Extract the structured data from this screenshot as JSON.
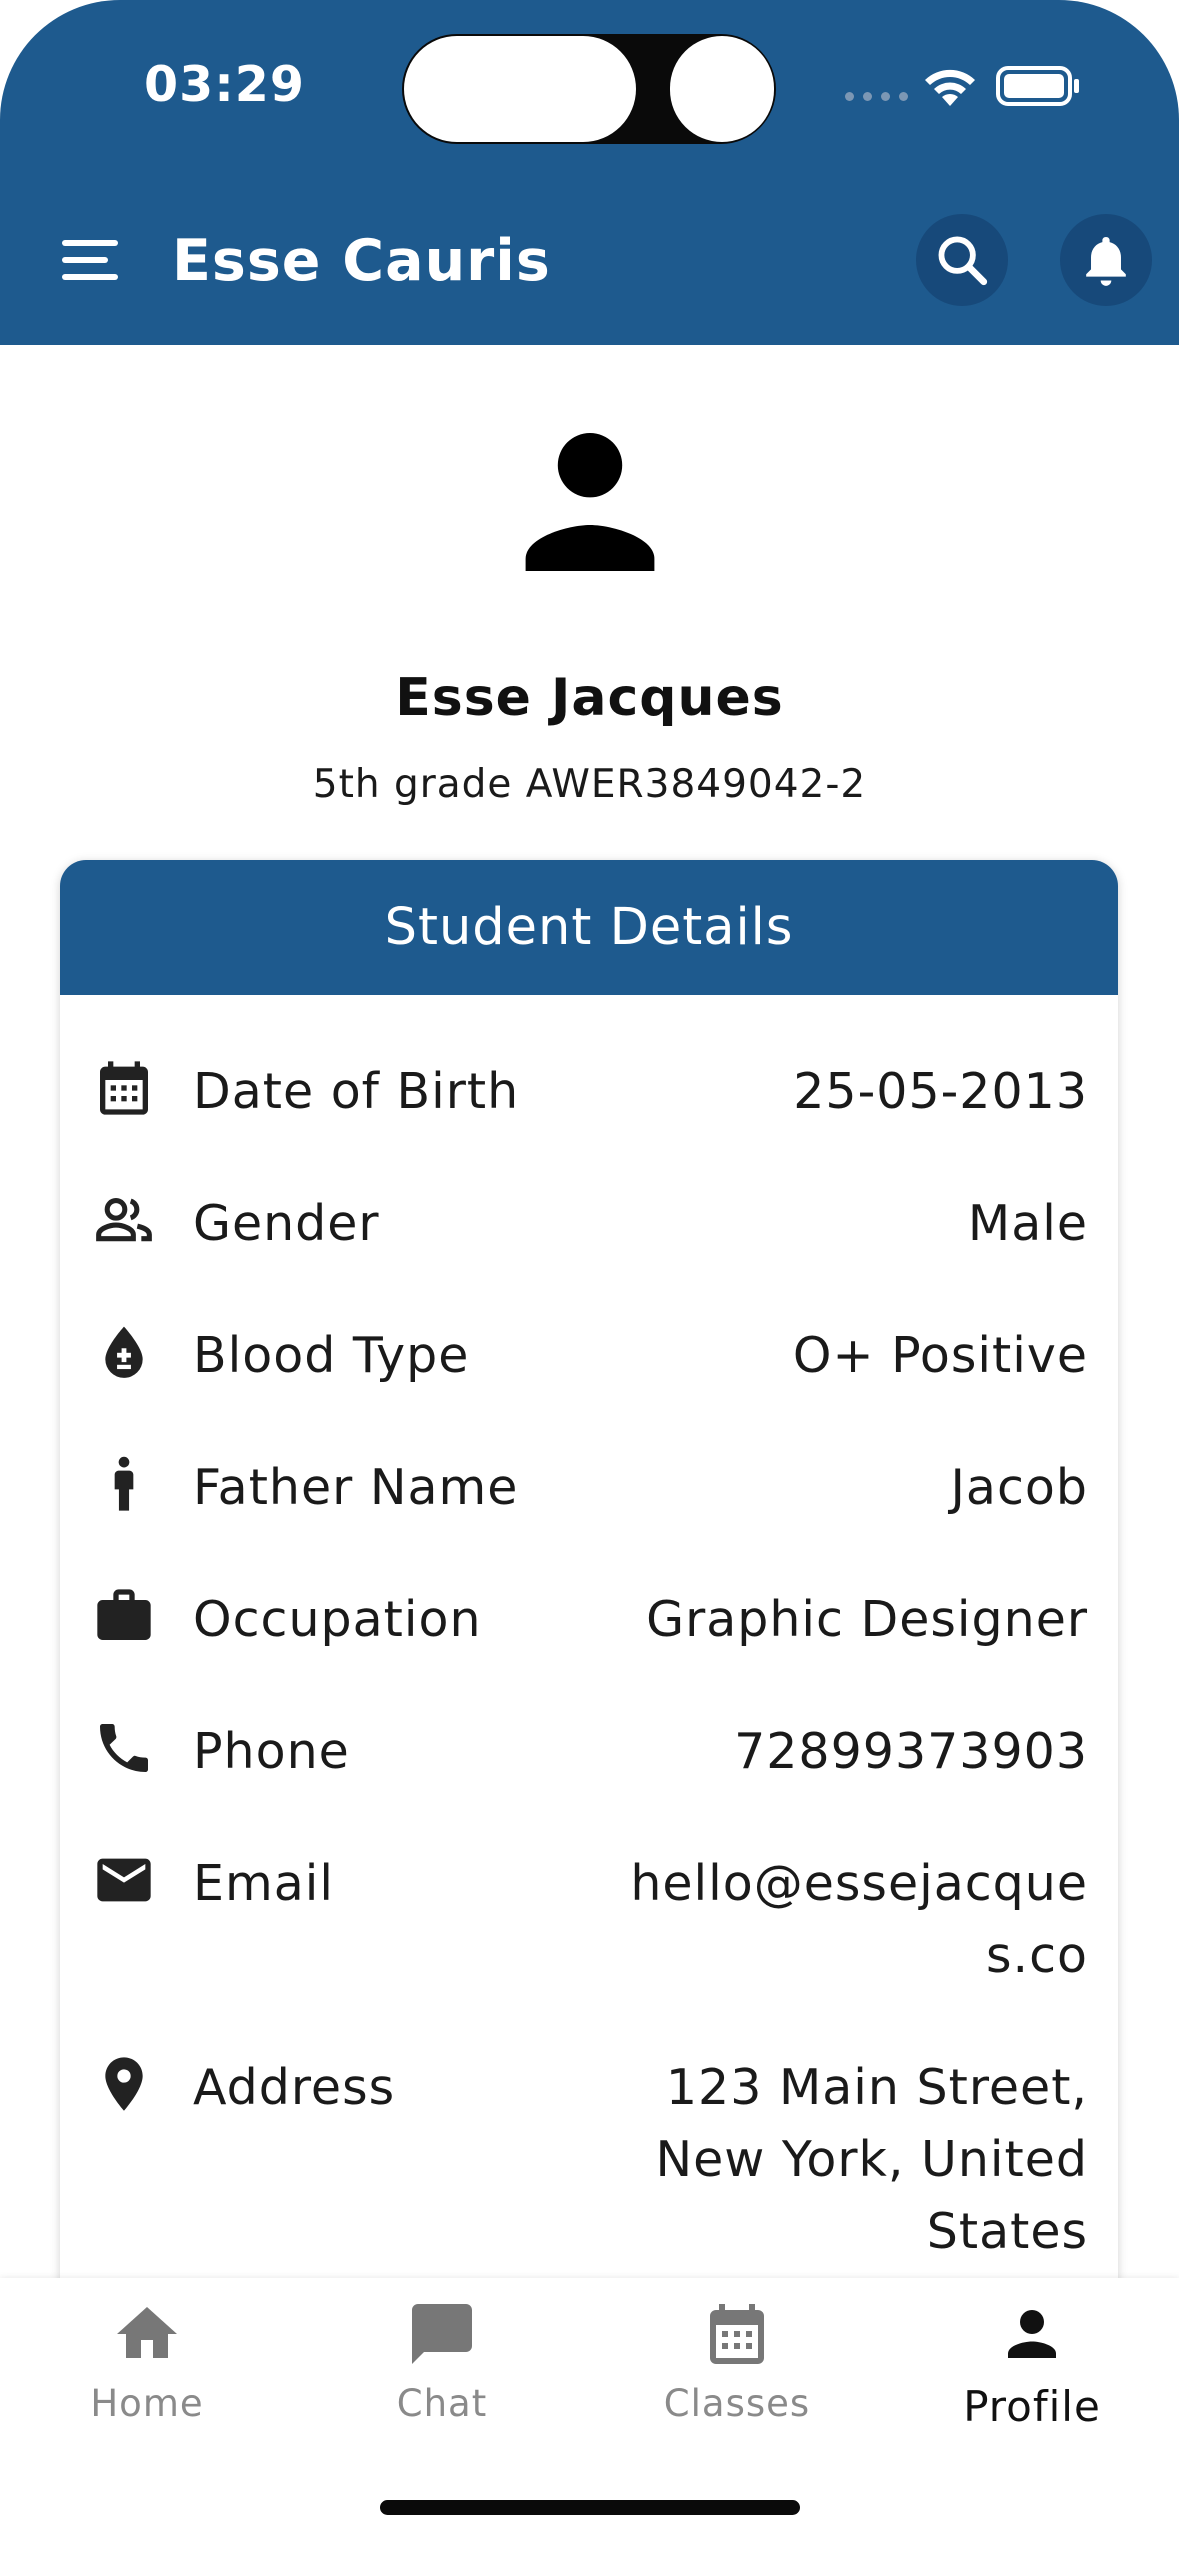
{
  "status_bar": {
    "time": "03:29"
  },
  "app_bar": {
    "title": "Esse Cauris",
    "menu_icon": "menu-icon",
    "search_icon": "search-icon",
    "notifications_icon": "bell-icon",
    "color": "#1e5a8e"
  },
  "profile": {
    "name": "Esse Jacques",
    "subtitle": "5th grade AWER3849042-2",
    "avatar_icon": "person-icon"
  },
  "details": {
    "heading": "Student Details",
    "rows": [
      {
        "icon": "calendar-icon",
        "label": "Date of Birth",
        "value": "25-05-2013"
      },
      {
        "icon": "people-icon",
        "label": "Gender",
        "value": "Male"
      },
      {
        "icon": "blood-drop-icon",
        "label": "Blood Type",
        "value": "O+ Positive"
      },
      {
        "icon": "man-icon",
        "label": "Father Name",
        "value": "Jacob"
      },
      {
        "icon": "briefcase-icon",
        "label": "Occupation",
        "value": "Graphic Designer"
      },
      {
        "icon": "phone-icon",
        "label": "Phone",
        "value": "72899373903"
      },
      {
        "icon": "mail-icon",
        "label": "Email",
        "value_lines": [
          "hello@essejacque",
          "s.co"
        ]
      },
      {
        "icon": "location-pin-icon",
        "label": "Address",
        "value_lines": [
          "123 Main Street,",
          "New York, United",
          "States"
        ]
      }
    ]
  },
  "bottom_nav": {
    "items": [
      {
        "label": "Home",
        "icon": "home-icon",
        "active": false
      },
      {
        "label": "Chat",
        "icon": "chat-icon",
        "active": false
      },
      {
        "label": "Classes",
        "icon": "calendar-icon",
        "active": false
      },
      {
        "label": "Profile",
        "icon": "person-icon",
        "active": true
      }
    ]
  }
}
